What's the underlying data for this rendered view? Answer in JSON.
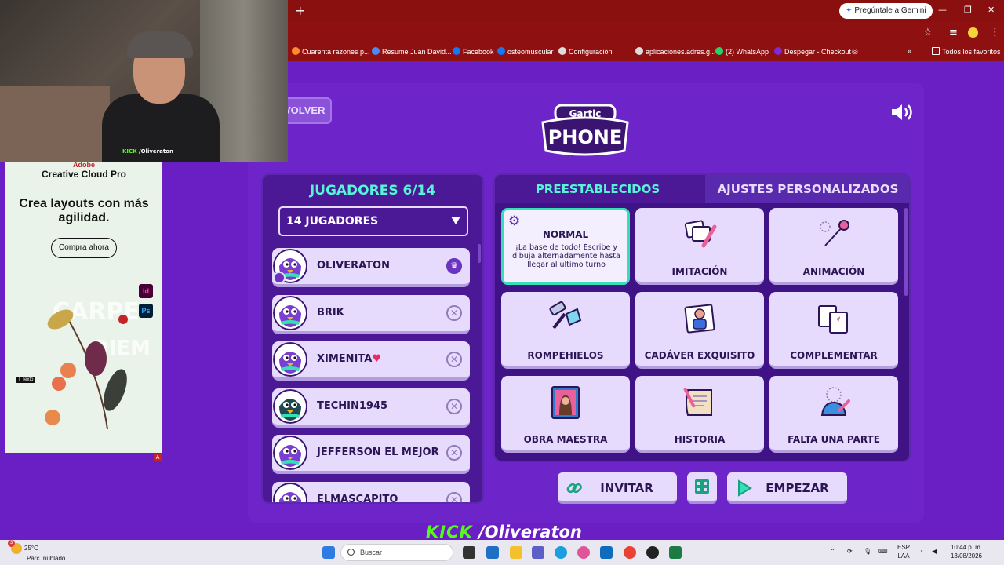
{
  "browser": {
    "gemini_label": "Pregúntale a Gemini",
    "bookmarks": [
      {
        "label": "Cuarenta razones p...",
        "color": "#ff8a2b"
      },
      {
        "label": "Resume Juan David...",
        "color": "#4a8af4"
      },
      {
        "label": "Facebook",
        "color": "#1877f2"
      },
      {
        "label": "osteomuscular",
        "color": "#1877f2"
      },
      {
        "label": "Configuración",
        "color": "#dddddd"
      },
      {
        "label": "aplicaciones.adres.g...",
        "color": "#dddddd"
      },
      {
        "label": "(2) WhatsApp",
        "color": "#25d366"
      },
      {
        "label": "Despegar - Checkout",
        "color": "#7b2bd9"
      }
    ],
    "all_bookmarks": "Todos los favoritos"
  },
  "webcam": {
    "tag_kick": "KICK",
    "tag_user": "/Oliveraton"
  },
  "ad": {
    "brand": "Adobe",
    "product": "Creative Cloud Pro",
    "headline": "Crea layouts con más agilidad.",
    "cta": "Compra ahora",
    "badge_id": "Id",
    "badge_ps": "Ps",
    "texto_chip": "T Texto"
  },
  "game": {
    "back_label": "VOLVER",
    "logo_top": "Gartic",
    "logo_bottom": "PHONE",
    "players_title": "JUGADORES 6/14",
    "players_select": "14 JUGADORES",
    "players": [
      {
        "name": "OLIVERATON",
        "host": true
      },
      {
        "name": "BRIK",
        "host": false
      },
      {
        "name": "XIMENITA",
        "host": false,
        "heart": "♥"
      },
      {
        "name": "TECHIN1945",
        "host": false
      },
      {
        "name": "JEFFERSON EL MEJOR",
        "host": false
      },
      {
        "name": "ELMASCAPITO",
        "host": false
      }
    ],
    "tab_presets": "PREESTABLECIDOS",
    "tab_custom": "AJUSTES PERSONALIZADOS",
    "selected_mode": {
      "title": "NORMAL",
      "description": "¡La base de todo! Escribe y dibuja alternadamente hasta llegar al último turno"
    },
    "modes": [
      "IMITACIÓN",
      "ANIMACIÓN",
      "ROMPEHIELOS",
      "CADÁVER EXQUISITO",
      "COMPLEMENTAR",
      "OBRA MAESTRA",
      "HISTORIA",
      "FALTA UNA PARTE"
    ],
    "invite_label": "INVITAR",
    "start_label": "EMPEZAR"
  },
  "stream_overlay": {
    "kick": "KICK",
    "user": "/Oliveraton"
  },
  "taskbar": {
    "temp": "25°C",
    "weather": "Parc. nublado",
    "search_placeholder": "Buscar",
    "lang_top": "ESP",
    "lang_bottom": "LAA",
    "time": "10:44 p. m.",
    "date": "13/08/2026",
    "weather_badge": "3"
  }
}
